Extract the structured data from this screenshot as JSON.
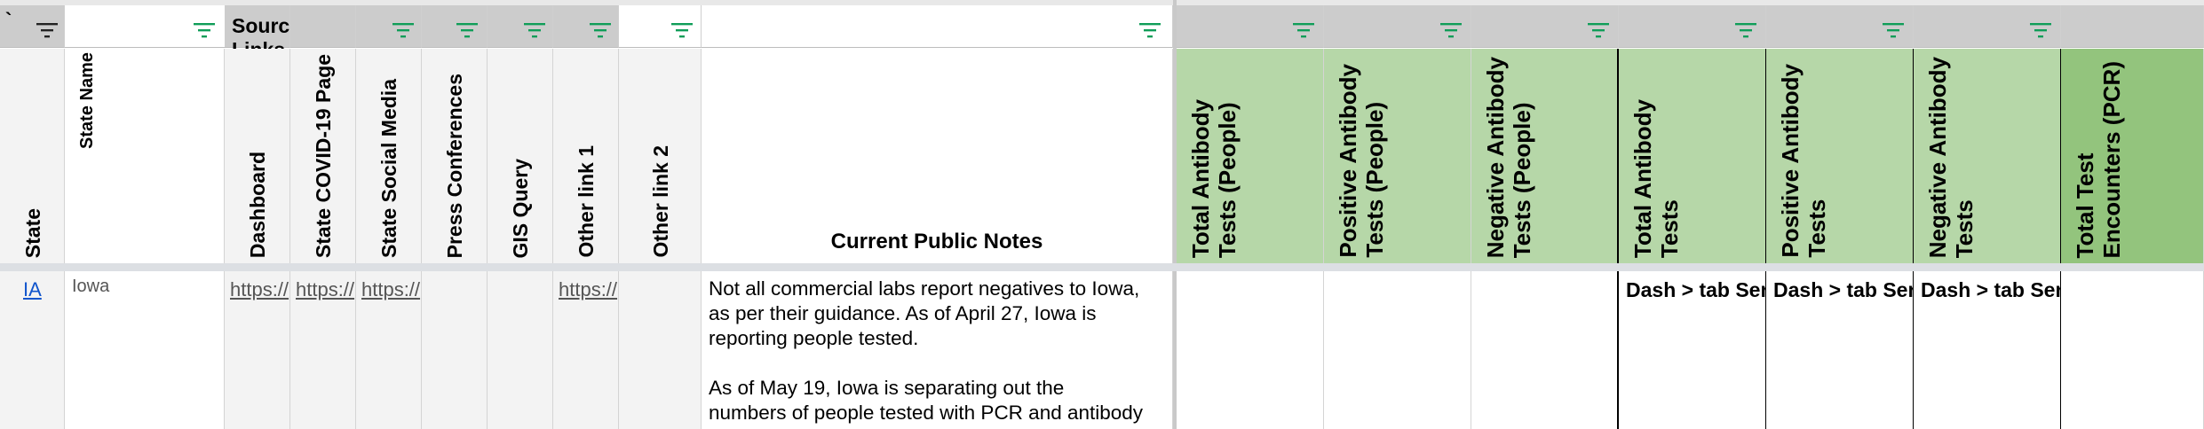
{
  "filter_row": {
    "corner_mark": "`",
    "source_links_label": "Source Links"
  },
  "headers": {
    "state": "State",
    "state_name": "State Name",
    "dashboard": "Dashboard",
    "state_covid_page": "State COVID-19 Page",
    "state_social_media": "State Social Media",
    "press_conferences": "Press Conferences",
    "gis_query": "GIS Query",
    "other_link_1": "Other link 1",
    "other_link_2": "Other link 2",
    "current_public_notes": "Current Public Notes",
    "total_antibody_people": "Total Antibody\nTests (People)",
    "positive_antibody_people": "Positive Antibody\nTests (People)",
    "negative_antibody_people": "Negative Antibody\nTests (People)",
    "total_antibody": "Total Antibody\nTests",
    "positive_antibody": "Positive Antibody\nTests",
    "negative_antibody": "Negative Antibody\nTests",
    "total_test_encounters": "Total Test\nEncounters (PCR)"
  },
  "row": {
    "state": "IA",
    "state_name": "Iowa",
    "dashboard": "https://",
    "state_covid_page": "https://",
    "state_social_media": "https://",
    "other_link_1": "https://",
    "notes": "Not all commercial labs report negatives to Iowa,\nas per their guidance. As of April 27, Iowa is\nreporting people tested.\n\nAs of May 19, Iowa is separating out the\nnumbers of people tested with PCR and antibody",
    "total_antibody": "Dash > tab Serology",
    "positive_antibody": "Dash > tab Serology",
    "negative_antibody": "Dash > tab Serology"
  },
  "colors": {
    "header_gray": "#f3f3f3",
    "filter_gray": "#cccccc",
    "green_light": "#b6d7a8",
    "green_dark": "#93c47d",
    "filter_icon_green": "#0f9d58",
    "link_blue": "#1155cc"
  }
}
